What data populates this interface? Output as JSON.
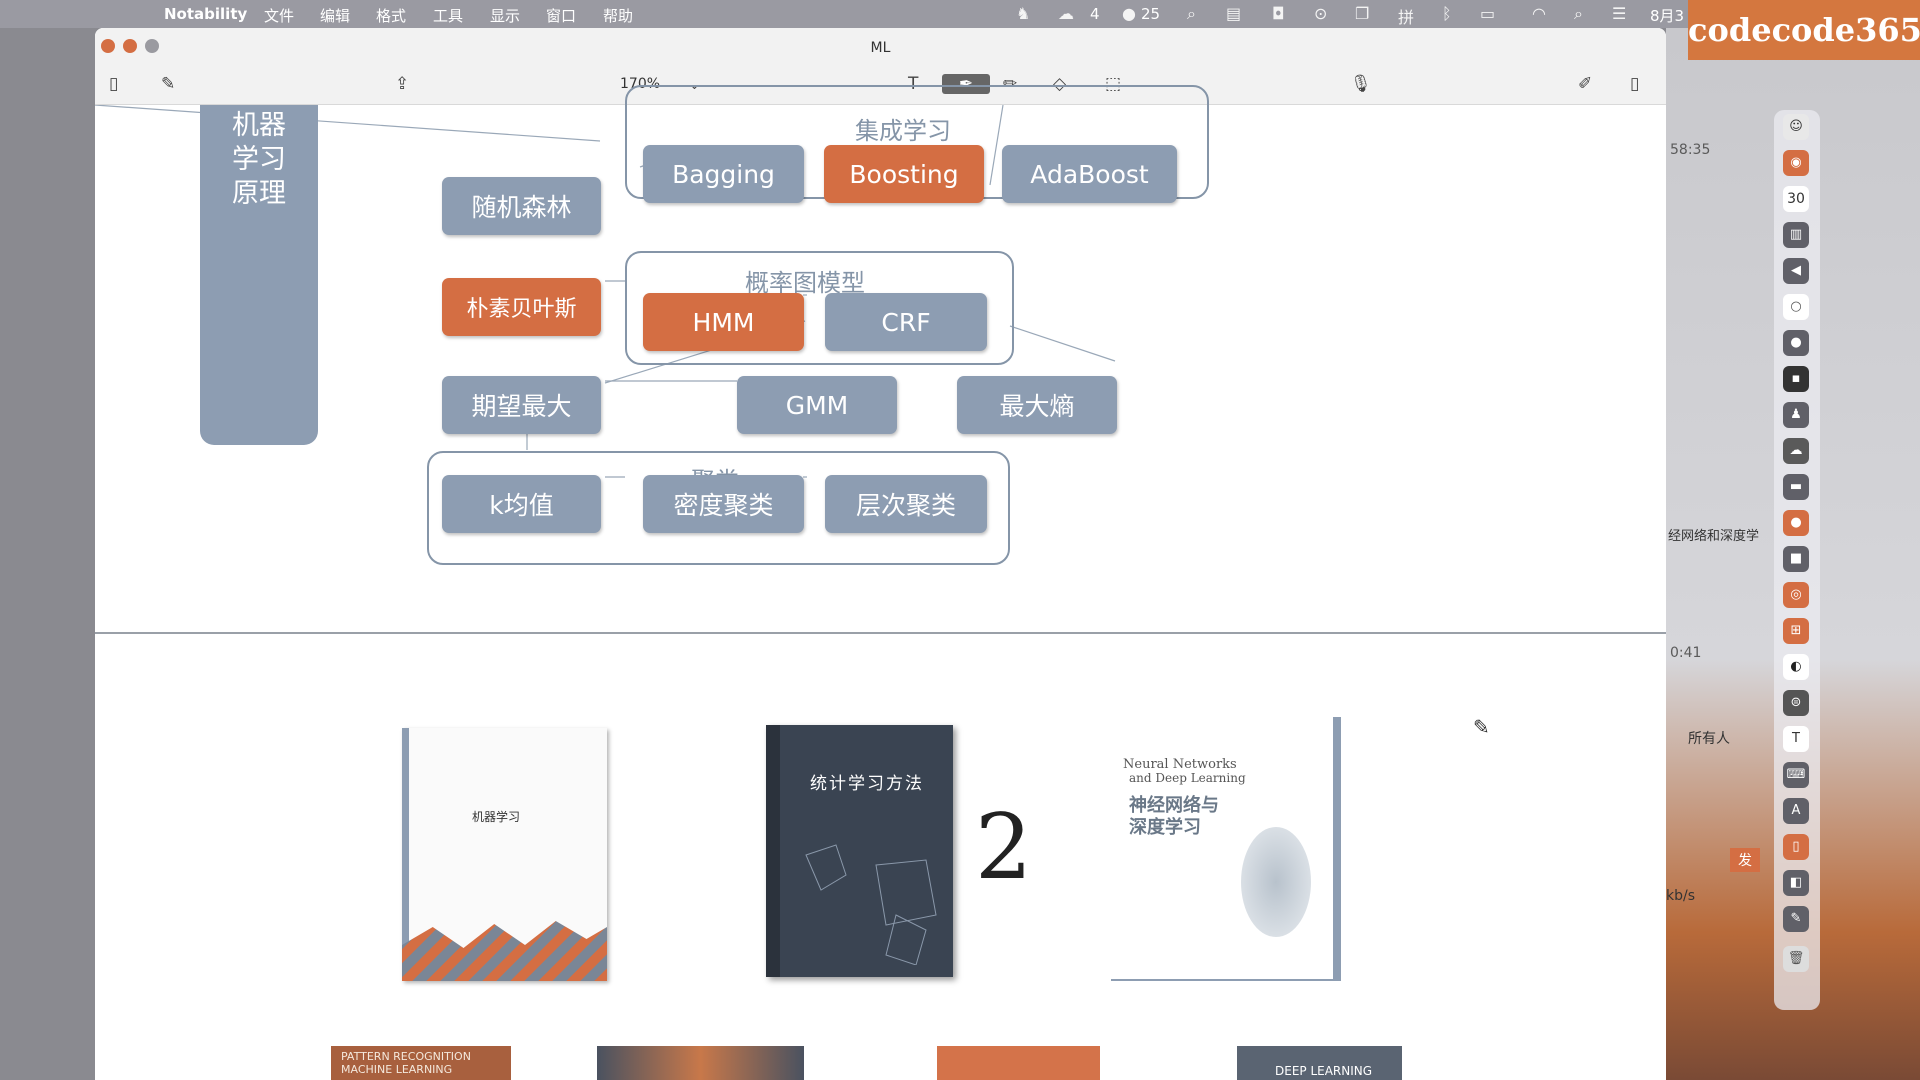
{
  "menubar": {
    "app": "Notability",
    "items": [
      "文件",
      "编辑",
      "格式",
      "工具",
      "显示",
      "窗口",
      "帮助"
    ],
    "status": {
      "wechat_count": "4",
      "badge_count": "25",
      "date": "8月3"
    }
  },
  "watermark": "codecode365",
  "window": {
    "title": "ML",
    "zoom": "170%"
  },
  "diagram": {
    "left_box": "机器学习原理",
    "groups": {
      "ensemble": "集成学习",
      "prob_graph": "概率图模型",
      "cluster": "聚类"
    },
    "nodes": {
      "random_forest": "随机森林",
      "bagging": "Bagging",
      "boosting": "Boosting",
      "adaboost": "AdaBoost",
      "naive_bayes": "朴素贝叶斯",
      "hmm": "HMM",
      "crf": "CRF",
      "em": "期望最大",
      "gmm": "GMM",
      "max_entropy": "最大熵",
      "kmeans": "k均值",
      "density_cluster": "密度聚类",
      "hier_cluster": "层次聚类"
    }
  },
  "books": {
    "book1": {
      "title": "机器学习"
    },
    "book2": {
      "title": "统计学习方法"
    },
    "handwritten": "2",
    "book3": {
      "title_en_1": "Neural Networks",
      "title_en_2": "and Deep Learning",
      "title_cn_1": "神经网络与",
      "title_cn_2": "深度学习"
    },
    "bottom": {
      "b1_1": "PATTERN RECOGNITION",
      "b1_2": "MACHINE LEARNING",
      "b4": "DEEP LEARNING"
    }
  },
  "right_panel": {
    "t1": "58:35",
    "t2": "经网络和深度学",
    "t3": "0:41",
    "t4": "所有人",
    "t5": "kb/s",
    "t6": "发",
    "dock_calendar": "30"
  },
  "colors": {
    "node_gray": "#8d9db2",
    "node_orange": "#d46e43",
    "watermark": "#d4773f"
  }
}
